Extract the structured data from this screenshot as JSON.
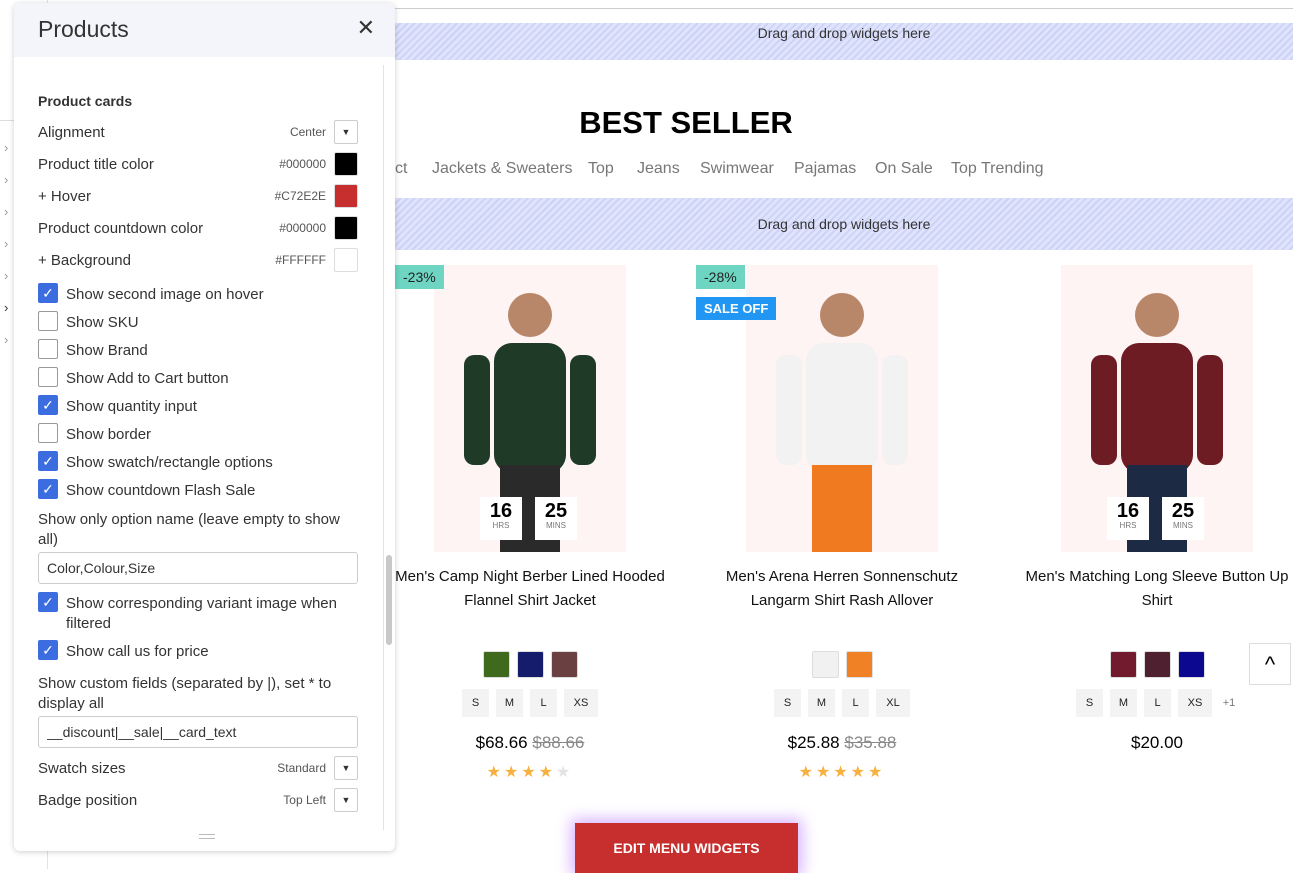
{
  "panel": {
    "title": "Products",
    "section": "Product cards",
    "alignment": {
      "label": "Alignment",
      "value": "Center"
    },
    "title_color": {
      "label": "Product title color",
      "value": "#000000"
    },
    "hover": {
      "label": "+ Hover",
      "value": "#C72E2E"
    },
    "countdown_color": {
      "label": "Product countdown color",
      "value": "#000000"
    },
    "background": {
      "label": "+ Background",
      "value": "#FFFFFF"
    },
    "checks": [
      {
        "label": "Show second image on hover",
        "checked": true
      },
      {
        "label": "Show SKU",
        "checked": false
      },
      {
        "label": "Show Brand",
        "checked": false
      },
      {
        "label": "Show Add to Cart button",
        "checked": false
      },
      {
        "label": "Show quantity input",
        "checked": true
      },
      {
        "label": "Show border",
        "checked": false
      },
      {
        "label": "Show swatch/rectangle options",
        "checked": true
      },
      {
        "label": "Show countdown Flash Sale",
        "checked": true
      }
    ],
    "option_name_label": "Show only option name (leave empty to show all)",
    "option_name_value": "Color,Colour,Size",
    "variant_image": {
      "label": "Show corresponding variant image when filtered",
      "checked": true
    },
    "call_price": {
      "label": "Show call us for price",
      "checked": true
    },
    "custom_fields_label": "Show custom fields (separated by |), set * to display all",
    "custom_fields_value": "__discount|__sale|__card_text",
    "swatch_sizes": {
      "label": "Swatch sizes",
      "value": "Standard"
    },
    "badge_position": {
      "label": "Badge position",
      "value": "Top Left"
    }
  },
  "main": {
    "drop_text": "Drag and drop widgets here",
    "title": "BEST SELLER",
    "tabs": [
      "ct",
      "Jackets & Sweaters",
      "Top",
      "Jeans",
      "Swimwear",
      "Pajamas",
      "On Sale",
      "Top Trending"
    ],
    "edit_button": "EDIT MENU WIDGETS",
    "products": [
      {
        "name1": "Men's Camp Night Berber Lined Hooded",
        "name2": "Flannel Shirt Jacket",
        "badge": "-23%",
        "price": "$68.66",
        "old": "$88.66",
        "rating": 4,
        "countdown": {
          "hrs": "16",
          "mins": "25",
          "hrs_label": "HRS",
          "mins_label": "MINS"
        },
        "swatches": [
          "#3f6a1e",
          "#141c6b",
          "#6b4040"
        ],
        "sizes": [
          "S",
          "M",
          "L",
          "XS"
        ]
      },
      {
        "name1": "Men's Arena Herren Sonnenschutz",
        "name2": "Langarm Shirt Rash Allover",
        "badge": "-28%",
        "badge2": "SALE OFF",
        "price": "$25.88",
        "old": "$35.88",
        "rating": 5,
        "swatches": [
          "#f1f1f1",
          "#f08124"
        ],
        "sizes": [
          "S",
          "M",
          "L",
          "XL"
        ]
      },
      {
        "name1": "Men's Matching Long Sleeve Button Up",
        "name2": "Shirt",
        "price": "$20.00",
        "countdown": {
          "hrs": "16",
          "mins": "25",
          "hrs_label": "HRS",
          "mins_label": "MINS"
        },
        "swatches": [
          "#721a2e",
          "#4f2030",
          "#0d0890"
        ],
        "sizes": [
          "S",
          "M",
          "L",
          "XS"
        ],
        "more": "+1"
      }
    ]
  },
  "colors": {
    "accent": "#3b6de0",
    "hover": "#C72E2E",
    "badge": "#6dd5c2",
    "sale": "#2196f3"
  }
}
